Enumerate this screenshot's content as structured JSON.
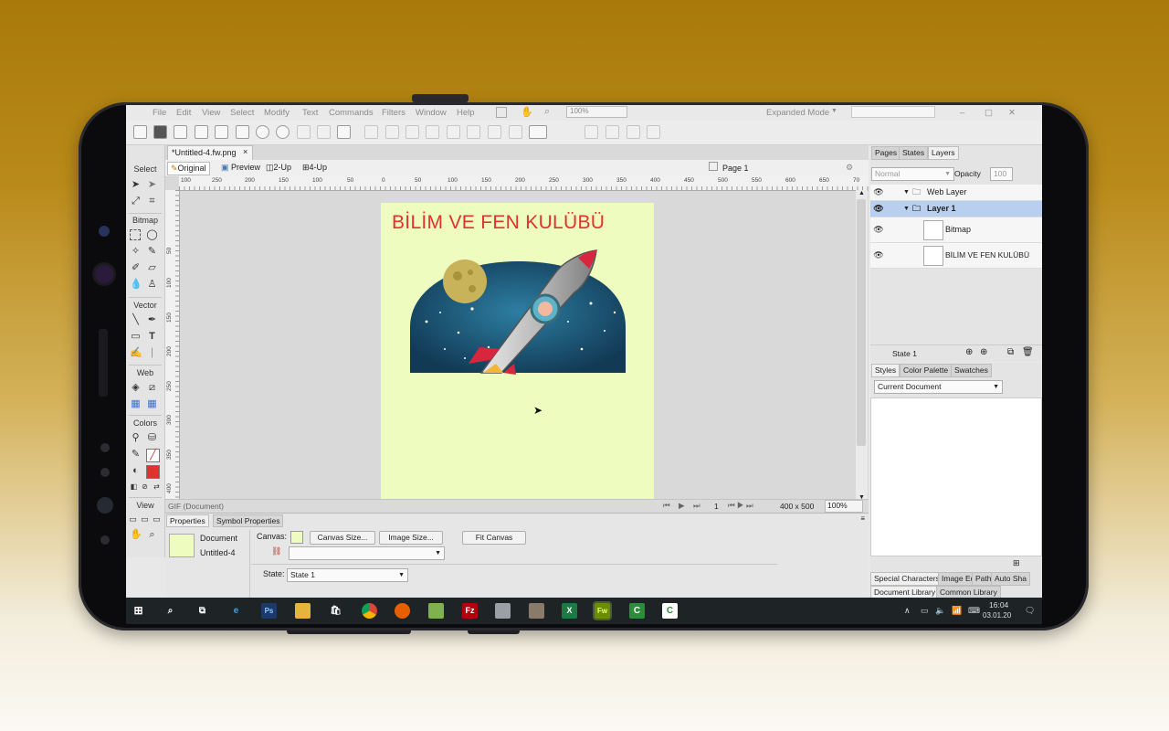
{
  "menu": [
    "File",
    "Edit",
    "View",
    "Select",
    "Modify",
    "Text",
    "Commands",
    "Filters",
    "Window",
    "Help"
  ],
  "zoom_box": "100%",
  "mode": "Expanded Mode",
  "doc_tab": "*Untitled-4.fw.png",
  "doc_tab_close": "×",
  "view_buttons": {
    "original": "Original",
    "preview": "Preview",
    "two_up": "2-Up",
    "four_up": "4-Up"
  },
  "page_label": "Page 1",
  "tools": {
    "select": "Select",
    "bitmap": "Bitmap",
    "vector": "Vector",
    "web": "Web",
    "colors": "Colors",
    "view": "View"
  },
  "ruler_h": [
    "100",
    "250",
    "200",
    "150",
    "100",
    "50",
    "0",
    "50",
    "100",
    "150",
    "200",
    "250",
    "300",
    "350",
    "400",
    "450",
    "500",
    "550",
    "600",
    "650",
    "70"
  ],
  "ruler_v": [
    "50",
    "100",
    "150",
    "200",
    "250",
    "300",
    "350",
    "400"
  ],
  "canvas_title": "BİLİM VE FEN KULÜBÜ",
  "status": {
    "left": "GIF (Document)",
    "page": "1",
    "size": "400 x 500",
    "zoom": "100%"
  },
  "properties": {
    "tabs": [
      "Properties",
      "Symbol Properties"
    ],
    "doc_type": "Document",
    "doc_name": "Untitled-4",
    "canvas_label": "Canvas:",
    "canvas_size_btn": "Canvas Size...",
    "image_size_btn": "Image Size...",
    "fit_canvas_btn": "Fit Canvas",
    "state_label": "State:",
    "state_value": "State 1"
  },
  "layers_panel": {
    "tabs": [
      "Pages",
      "States",
      "Layers"
    ],
    "blend": "Normal",
    "opacity_label": "Opacity",
    "opacity": "100",
    "rows": [
      "Web Layer",
      "Layer 1",
      "Bitmap",
      "BİLİM VE FEN KULÜBÜ"
    ],
    "state": "State 1"
  },
  "styles_panel": {
    "tabs": [
      "Styles",
      "Color Palette",
      "Swatches"
    ],
    "select": "Current Document"
  },
  "bottom_tabs": {
    "row1": [
      "Special Characters",
      "Image Ed",
      "Path",
      "Auto Sha"
    ],
    "row2": [
      "Document Library",
      "Common Library"
    ]
  },
  "taskbar": {
    "time": "16:04",
    "date": "03.01.20"
  },
  "colors": {
    "accent_title": "#e0322e",
    "canvas_bg": "#eefcbf",
    "layer_selected": "#b9cff0"
  }
}
